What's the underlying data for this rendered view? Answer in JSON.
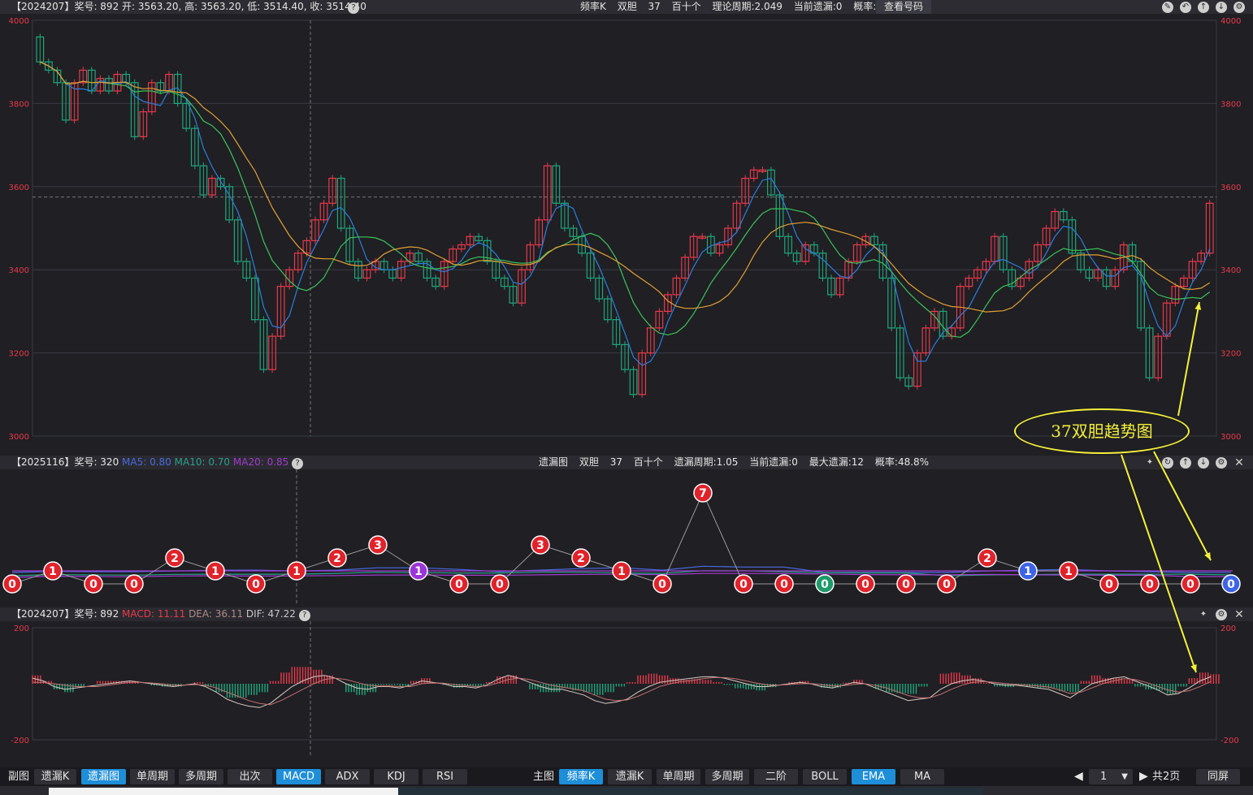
{
  "main_panel": {
    "info": "【2024207】奖号: 892  开: 3563.20, 高: 3563.20, 低: 3514.40, 收: 3514.40",
    "help_icon": "help-icon",
    "center": [
      "频率K",
      "双胆",
      "37",
      "百十个",
      "理论周期:2.049",
      "当前遗漏:0",
      "概率:48.8%"
    ],
    "lookup": "查看号码",
    "icons": [
      "edit-icon",
      "back-icon",
      "up-icon",
      "down-icon",
      "settings-icon"
    ],
    "y_ticks": [
      "4000",
      "3800",
      "3600",
      "3400",
      "3200",
      "3000"
    ],
    "colors": {
      "up": "#e83a4a",
      "down": "#21a77a",
      "ma_blue": "#2b7fe0",
      "ma_green": "#3cc45a",
      "ma_orange": "#e3a032",
      "grid": "#3a3a42"
    },
    "chart_data": {
      "type": "candlestick",
      "ylim": [
        3000,
        4000
      ],
      "y_ticks": [
        4000,
        3800,
        3600,
        3400,
        3200,
        3000
      ],
      "close": [
        3900,
        3880,
        3850,
        3760,
        3850,
        3880,
        3830,
        3860,
        3830,
        3870,
        3850,
        3720,
        3780,
        3850,
        3830,
        3870,
        3800,
        3740,
        3650,
        3580,
        3620,
        3600,
        3520,
        3420,
        3380,
        3280,
        3160,
        3240,
        3360,
        3400,
        3440,
        3470,
        3520,
        3560,
        3620,
        3500,
        3420,
        3380,
        3400,
        3420,
        3400,
        3380,
        3420,
        3440,
        3420,
        3380,
        3360,
        3420,
        3450,
        3460,
        3480,
        3470,
        3420,
        3380,
        3360,
        3320,
        3400,
        3460,
        3520,
        3650,
        3560,
        3500,
        3480,
        3440,
        3380,
        3330,
        3280,
        3220,
        3160,
        3100,
        3200,
        3260,
        3300,
        3340,
        3380,
        3430,
        3480,
        3480,
        3440,
        3460,
        3500,
        3560,
        3620,
        3640,
        3640,
        3580,
        3480,
        3440,
        3420,
        3460,
        3440,
        3380,
        3340,
        3380,
        3420,
        3460,
        3480,
        3460,
        3380,
        3260,
        3140,
        3120,
        3200,
        3260,
        3300,
        3240,
        3260,
        3360,
        3380,
        3400,
        3420,
        3480,
        3400,
        3360,
        3380,
        3420,
        3460,
        3500,
        3540,
        3520,
        3440,
        3400,
        3380,
        3400,
        3360,
        3400,
        3460,
        3420,
        3260,
        3140,
        3240,
        3320,
        3360,
        3380,
        3420,
        3440,
        3560
      ]
    }
  },
  "omit_panel": {
    "info_prefix": "【2025116】奖号: 320",
    "ma5": "MA5: 0.80",
    "ma10": "MA10: 0.70",
    "ma20": "MA20: 0.85",
    "center": [
      "遗漏图",
      "双胆",
      "37",
      "百十个",
      "遗漏周期:1.05",
      "当前遗漏:0",
      "最大遗漏:12",
      "概率:48.8%"
    ],
    "icons": [
      "pin-icon",
      "refresh-icon",
      "up-icon",
      "down-icon",
      "settings-icon",
      "close-icon"
    ],
    "colors": {
      "red": "#e0222a",
      "purple": "#9a35d8",
      "green": "#1e9a6a",
      "blue": "#3d64e6",
      "ma5": "#4a6be0",
      "ma10": "#2aa08a",
      "ma20": "#a43bd0"
    },
    "chart_data": {
      "type": "line",
      "values": [
        0,
        1,
        0,
        0,
        2,
        1,
        0,
        1,
        2,
        3,
        1,
        0,
        0,
        3,
        2,
        1,
        0,
        7,
        0,
        0,
        0,
        0,
        0,
        0,
        2,
        1,
        1,
        0,
        0,
        0,
        0
      ],
      "point_colors": [
        "red",
        "red",
        "red",
        "red",
        "red",
        "red",
        "red",
        "red",
        "red",
        "red",
        "purple",
        "red",
        "red",
        "red",
        "red",
        "red",
        "red",
        "red",
        "red",
        "red",
        "green",
        "red",
        "red",
        "red",
        "red",
        "blue",
        "red",
        "red",
        "red",
        "red",
        "blue"
      ]
    }
  },
  "macd_panel": {
    "info_prefix": "【2024207】奖号: 892",
    "macd": "MACD: 11.11",
    "dea": "DEA: 36.11",
    "dif": "DIF: 47.22",
    "icons": [
      "pin-icon",
      "settings-icon",
      "close-icon"
    ],
    "y_top": "200",
    "y_bottom": "-200",
    "chart_data": {
      "type": "bar",
      "ylim": [
        -200,
        200
      ],
      "dif": [
        20,
        10,
        -10,
        -20,
        -15,
        -10,
        -5,
        0,
        5,
        10,
        5,
        0,
        -5,
        -10,
        -5,
        0,
        -10,
        -30,
        -55,
        -70,
        -80,
        -85,
        -70,
        -40,
        -10,
        10,
        25,
        30,
        20,
        0,
        -15,
        -20,
        -10,
        -10,
        -15,
        -5,
        10,
        5,
        0,
        -10,
        -10,
        -15,
        -5,
        15,
        30,
        20,
        5,
        -10,
        -20,
        -20,
        -30,
        -40,
        -60,
        -70,
        -65,
        -55,
        -30,
        -10,
        5,
        10,
        15,
        20,
        25,
        25,
        20,
        10,
        0,
        -10,
        -10,
        -5,
        0,
        5,
        0,
        -10,
        -15,
        -5,
        5,
        0,
        -15,
        -30,
        -45,
        -60,
        -55,
        -50,
        -20,
        0,
        10,
        15,
        10,
        0,
        -5,
        -5,
        -10,
        -15,
        -20,
        -35,
        -50,
        -25,
        0,
        10,
        20,
        25,
        10,
        -5,
        -20,
        -40,
        -35,
        -15,
        10,
        25
      ],
      "dea": [
        5,
        5,
        0,
        -5,
        -10,
        -10,
        -10,
        -5,
        0,
        5,
        5,
        3,
        0,
        -5,
        -5,
        -3,
        -5,
        -15,
        -30,
        -45,
        -60,
        -70,
        -75,
        -60,
        -40,
        -20,
        0,
        15,
        20,
        15,
        5,
        -5,
        -8,
        -8,
        -10,
        -10,
        0,
        3,
        2,
        -3,
        -6,
        -10,
        -8,
        2,
        15,
        20,
        15,
        5,
        -5,
        -12,
        -18,
        -25,
        -40,
        -55,
        -60,
        -58,
        -45,
        -28,
        -10,
        0,
        8,
        12,
        18,
        22,
        22,
        18,
        10,
        2,
        -4,
        -5,
        -3,
        0,
        1,
        -3,
        -8,
        -7,
        -2,
        0,
        -6,
        -15,
        -28,
        -42,
        -50,
        -50,
        -38,
        -20,
        -5,
        5,
        8,
        5,
        1,
        -2,
        -5,
        -8,
        -12,
        -22,
        -35,
        -30,
        -15,
        0,
        10,
        18,
        15,
        5,
        -8,
        -22,
        -30,
        -25,
        -10,
        8
      ]
    }
  },
  "callout": {
    "text": "37双胆趋势图",
    "color": "#f4f03a"
  },
  "toolbar": {
    "left_label": "副图",
    "left_buttons": [
      "遗漏K",
      "遗漏图",
      "单周期",
      "多周期",
      "出次",
      "MACD",
      "ADX",
      "KDJ",
      "RSI"
    ],
    "left_active": [
      "遗漏图",
      "MACD"
    ],
    "right_label": "主图",
    "right_buttons": [
      "频率K",
      "遗漏K",
      "单周期",
      "多周期",
      "二阶",
      "BOLL",
      "EMA",
      "MA"
    ],
    "right_active": [
      "频率K",
      "EMA"
    ],
    "page_prev": "prev-arrow-icon",
    "page_value": "1",
    "page_next": "next-arrow-icon",
    "page_total": "共2页",
    "same_screen": "同屏"
  }
}
